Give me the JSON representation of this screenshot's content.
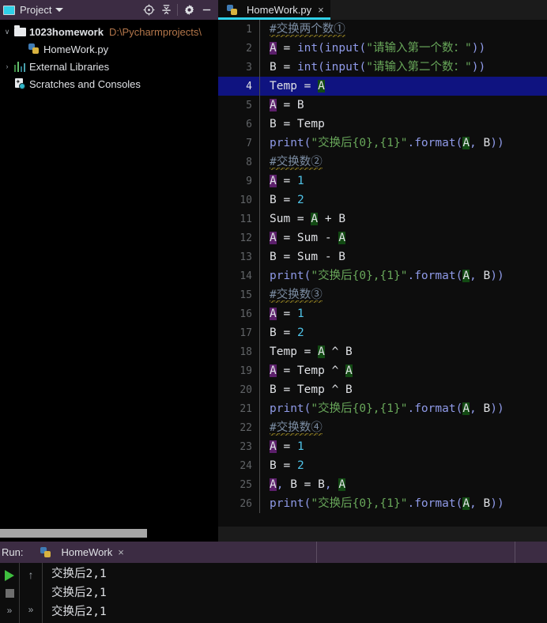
{
  "project_panel": {
    "title": "Project",
    "icon": "project-window-icon",
    "toolbar": [
      {
        "name": "locate-target-icon",
        "label": "Select Opened File"
      },
      {
        "name": "collapse-all-icon",
        "label": "Collapse All"
      },
      {
        "name": "gear-icon",
        "label": "Settings"
      },
      {
        "name": "minimize-icon",
        "label": "Hide"
      }
    ],
    "tree": [
      {
        "name": "sidebar-item-project-root",
        "label": "1023homework",
        "path": "D:\\Pycharmprojects\\",
        "icon": "folder-icon",
        "arrow": "∨",
        "bold": true,
        "indent": 0
      },
      {
        "name": "sidebar-item-homework-py",
        "label": "HomeWork.py",
        "path": "",
        "icon": "python-file-icon",
        "arrow": "",
        "bold": false,
        "indent": 2
      },
      {
        "name": "sidebar-item-external-libraries",
        "label": "External Libraries",
        "path": "",
        "icon": "library-bars-icon",
        "arrow": "›",
        "bold": false,
        "indent": 0
      },
      {
        "name": "sidebar-item-scratches-consoles",
        "label": "Scratches and Consoles",
        "path": "",
        "icon": "scratches-icon",
        "arrow": "",
        "bold": false,
        "indent": 0
      }
    ]
  },
  "editor": {
    "tab": {
      "name": "HomeWork.py",
      "icon": "python-file-icon",
      "close": "×"
    },
    "active_line": 4,
    "lines": [
      {
        "n": "1",
        "tokens": [
          {
            "t": "#交换两个数①",
            "c": "comment squig"
          }
        ]
      },
      {
        "n": "2",
        "tokens": [
          {
            "t": "A",
            "c": "wA"
          },
          {
            "t": " = ",
            "c": "punc"
          },
          {
            "t": "int",
            "c": "kw-fn"
          },
          {
            "t": "(",
            "c": "kw-fn"
          },
          {
            "t": "input",
            "c": "kw-fn"
          },
          {
            "t": "(",
            "c": "kw-fn"
          },
          {
            "t": "\"请输入第一个数：\"",
            "c": "str"
          },
          {
            "t": "))",
            "c": "kw-fn"
          }
        ]
      },
      {
        "n": "3",
        "tokens": [
          {
            "t": "B",
            "c": "punc"
          },
          {
            "t": " = ",
            "c": "punc"
          },
          {
            "t": "int",
            "c": "kw-fn"
          },
          {
            "t": "(",
            "c": "kw-fn"
          },
          {
            "t": "input",
            "c": "kw-fn"
          },
          {
            "t": "(",
            "c": "kw-fn"
          },
          {
            "t": "\"请输入第二个数：\"",
            "c": "str"
          },
          {
            "t": "))",
            "c": "kw-fn"
          }
        ]
      },
      {
        "n": "4",
        "tokens": [
          {
            "t": "Temp",
            "c": "punc"
          },
          {
            "t": " = ",
            "c": "punc"
          },
          {
            "t": "A",
            "c": "rA"
          }
        ]
      },
      {
        "n": "5",
        "tokens": [
          {
            "t": "A",
            "c": "wA"
          },
          {
            "t": " = B",
            "c": "punc"
          }
        ]
      },
      {
        "n": "6",
        "tokens": [
          {
            "t": "B = Temp",
            "c": "punc"
          }
        ]
      },
      {
        "n": "7",
        "tokens": [
          {
            "t": "print",
            "c": "kw-fn"
          },
          {
            "t": "(",
            "c": "kw-fn"
          },
          {
            "t": "\"交换后{0},{1}\"",
            "c": "str"
          },
          {
            "t": ".format",
            "c": "kw-fn"
          },
          {
            "t": "(",
            "c": "kw-fn"
          },
          {
            "t": "A",
            "c": "rA"
          },
          {
            "t": ",",
            "c": "kw-fn"
          },
          {
            "t": " B",
            "c": "punc"
          },
          {
            "t": "))",
            "c": "kw-fn"
          }
        ]
      },
      {
        "n": "8",
        "tokens": [
          {
            "t": "#交换数②",
            "c": "comment squig"
          }
        ]
      },
      {
        "n": "9",
        "tokens": [
          {
            "t": "A",
            "c": "wA"
          },
          {
            "t": " = ",
            "c": "punc"
          },
          {
            "t": "1",
            "c": "num"
          }
        ]
      },
      {
        "n": "10",
        "tokens": [
          {
            "t": "B",
            "c": "punc"
          },
          {
            "t": " = ",
            "c": "punc"
          },
          {
            "t": "2",
            "c": "num"
          }
        ]
      },
      {
        "n": "11",
        "tokens": [
          {
            "t": "Sum = ",
            "c": "punc"
          },
          {
            "t": "A",
            "c": "rA"
          },
          {
            "t": " + B",
            "c": "punc"
          }
        ]
      },
      {
        "n": "12",
        "tokens": [
          {
            "t": "A",
            "c": "wA"
          },
          {
            "t": " = Sum - ",
            "c": "punc"
          },
          {
            "t": "A",
            "c": "rA"
          }
        ]
      },
      {
        "n": "13",
        "tokens": [
          {
            "t": "B = Sum - B",
            "c": "punc"
          }
        ]
      },
      {
        "n": "14",
        "tokens": [
          {
            "t": "print",
            "c": "kw-fn"
          },
          {
            "t": "(",
            "c": "kw-fn"
          },
          {
            "t": "\"交换后{0},{1}\"",
            "c": "str"
          },
          {
            "t": ".format",
            "c": "kw-fn"
          },
          {
            "t": "(",
            "c": "kw-fn"
          },
          {
            "t": "A",
            "c": "rA"
          },
          {
            "t": ",",
            "c": "kw-fn"
          },
          {
            "t": " B",
            "c": "punc"
          },
          {
            "t": "))",
            "c": "kw-fn"
          }
        ]
      },
      {
        "n": "15",
        "tokens": [
          {
            "t": "#交换数③",
            "c": "comment squig"
          }
        ]
      },
      {
        "n": "16",
        "tokens": [
          {
            "t": "A",
            "c": "wA"
          },
          {
            "t": " = ",
            "c": "punc"
          },
          {
            "t": "1",
            "c": "num"
          }
        ]
      },
      {
        "n": "17",
        "tokens": [
          {
            "t": "B",
            "c": "punc"
          },
          {
            "t": " = ",
            "c": "punc"
          },
          {
            "t": "2",
            "c": "num"
          }
        ]
      },
      {
        "n": "18",
        "tokens": [
          {
            "t": "Temp = ",
            "c": "punc"
          },
          {
            "t": "A",
            "c": "rA"
          },
          {
            "t": " ^ B",
            "c": "punc"
          }
        ]
      },
      {
        "n": "19",
        "tokens": [
          {
            "t": "A",
            "c": "wA"
          },
          {
            "t": " = Temp ^ ",
            "c": "punc"
          },
          {
            "t": "A",
            "c": "rA"
          }
        ]
      },
      {
        "n": "20",
        "tokens": [
          {
            "t": "B = Temp ^ B",
            "c": "punc"
          }
        ]
      },
      {
        "n": "21",
        "tokens": [
          {
            "t": "print",
            "c": "kw-fn"
          },
          {
            "t": "(",
            "c": "kw-fn"
          },
          {
            "t": "\"交换后{0},{1}\"",
            "c": "str"
          },
          {
            "t": ".format",
            "c": "kw-fn"
          },
          {
            "t": "(",
            "c": "kw-fn"
          },
          {
            "t": "A",
            "c": "rA"
          },
          {
            "t": ",",
            "c": "kw-fn"
          },
          {
            "t": " B",
            "c": "punc"
          },
          {
            "t": "))",
            "c": "kw-fn"
          }
        ]
      },
      {
        "n": "22",
        "tokens": [
          {
            "t": "#交换数④",
            "c": "comment squig"
          }
        ]
      },
      {
        "n": "23",
        "tokens": [
          {
            "t": "A",
            "c": "wA"
          },
          {
            "t": " = ",
            "c": "punc"
          },
          {
            "t": "1",
            "c": "num"
          }
        ]
      },
      {
        "n": "24",
        "tokens": [
          {
            "t": "B",
            "c": "punc"
          },
          {
            "t": " = ",
            "c": "punc"
          },
          {
            "t": "2",
            "c": "num"
          }
        ]
      },
      {
        "n": "25",
        "tokens": [
          {
            "t": "A",
            "c": "wA"
          },
          {
            "t": ",",
            "c": "kw-fn"
          },
          {
            "t": " B = B",
            "c": "punc"
          },
          {
            "t": ",",
            "c": "kw-fn"
          },
          {
            "t": " ",
            "c": "punc"
          },
          {
            "t": "A",
            "c": "rA"
          }
        ]
      },
      {
        "n": "26",
        "tokens": [
          {
            "t": "print",
            "c": "kw-fn"
          },
          {
            "t": "(",
            "c": "kw-fn"
          },
          {
            "t": "\"交换后{0},{1}\"",
            "c": "str"
          },
          {
            "t": ".format",
            "c": "kw-fn"
          },
          {
            "t": "(",
            "c": "kw-fn"
          },
          {
            "t": "A",
            "c": "rA"
          },
          {
            "t": ",",
            "c": "kw-fn"
          },
          {
            "t": " B",
            "c": "punc"
          },
          {
            "t": "))",
            "c": "kw-fn"
          }
        ]
      }
    ]
  },
  "run_panel": {
    "label": "Run:",
    "tab": {
      "name": "HomeWork",
      "icon": "python-file-icon",
      "close": "×"
    },
    "controls": [
      {
        "name": "run-button",
        "icon": "play-icon"
      },
      {
        "name": "stop-button",
        "icon": "stop-icon"
      },
      {
        "name": "expand-output-button",
        "icon": "chevrons-icon",
        "glyph": "»"
      }
    ],
    "gutter2": [
      {
        "name": "scroll-up-button",
        "icon": "arrow-up-icon",
        "glyph": "↑"
      },
      {
        "name": "soft-wrap-button",
        "icon": "chevrons-icon",
        "glyph": "»"
      }
    ],
    "output": [
      "交换后2,1",
      "交换后2,1",
      "交换后2,1"
    ]
  },
  "colors": {
    "panel_header": "#3c2c43",
    "editor_bg": "#0d0d0d",
    "accent_cyan": "#2fd0e8",
    "active_line": "#0f1380",
    "string_green": "#69a85a",
    "function_blue": "#8f9ae8",
    "number_cyan": "#4fc3e8",
    "comment_gray": "#7c8da3",
    "write_highlight": "#5c1f6b",
    "read_highlight": "#124a13",
    "path_orange": "#b3764a"
  }
}
